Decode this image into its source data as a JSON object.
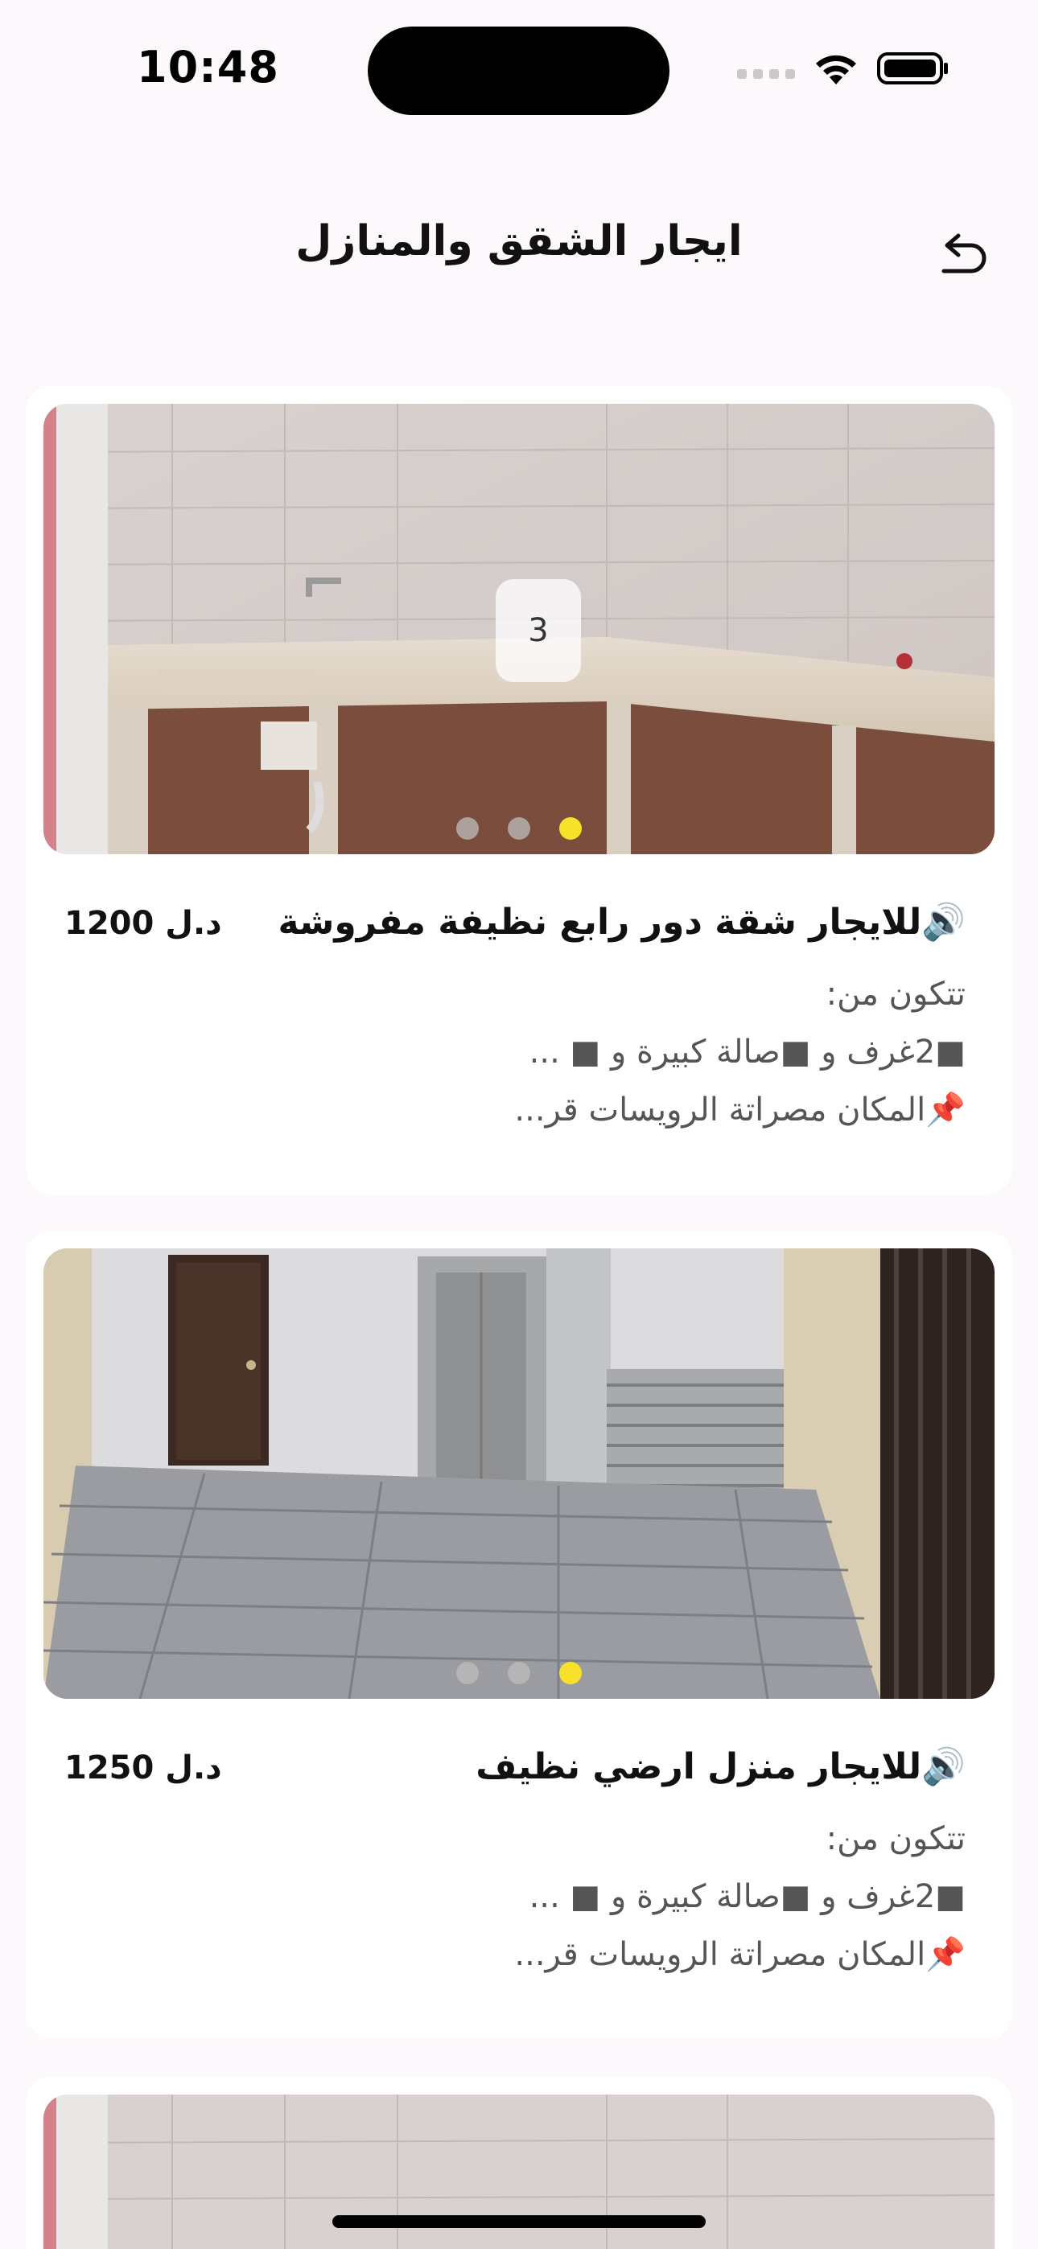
{
  "status_bar": {
    "time": "10:48"
  },
  "header": {
    "title": "ايجار الشقق والمنازل",
    "back_icon": "back-arrow-icon"
  },
  "listings": [
    {
      "title": "🔊للايجار شقة دور رابع  نظيفة مفروشة",
      "price": "1200 د.ل",
      "photo_counter": "3",
      "description": [
        "تتكون من:",
        "■2غرف و ■صالة كبيرة و ■ ...",
        "📌المكان مصراتة الرويسات قر..."
      ]
    },
    {
      "title": "🔊للايجار منزل ارضي نظيف",
      "price": "1250 د.ل",
      "description": [
        "تتكون من:",
        "■2غرف و ■صالة كبيرة و ■ ...",
        "📌المكان مصراتة الرويسات قر..."
      ]
    }
  ],
  "colors": {
    "background": "#fcf8fc",
    "card": "#ffffff",
    "active_dot": "#f7e12a"
  }
}
